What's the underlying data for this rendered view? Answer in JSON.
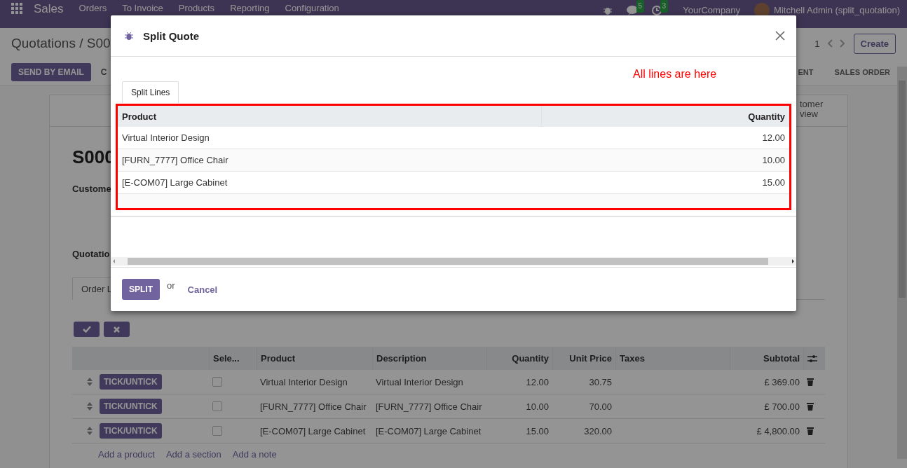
{
  "navbar": {
    "app": "Sales",
    "menu": [
      "Orders",
      "To Invoice",
      "Products",
      "Reporting",
      "Configuration"
    ],
    "chat_count": "5",
    "activity_count": "3",
    "company": "YourCompany",
    "user": "Mitchell Admin (split_quotation)"
  },
  "control_panel": {
    "breadcrumb": "Quotations / S00",
    "pager": "1",
    "create": "Create",
    "actions": [
      "SEND BY EMAIL",
      "C"
    ],
    "stages": [
      "ENT",
      "SALES ORDER"
    ]
  },
  "form": {
    "smart_button": "tomer view",
    "title": "S000",
    "fields": [
      "Custome",
      "Quotatio"
    ],
    "tab": "Order L",
    "table": {
      "columns": [
        "Sele...",
        "Product",
        "Description",
        "Quantity",
        "Unit Price",
        "Taxes",
        "Subtotal"
      ],
      "rows": [
        {
          "button": "TICK/UNTICK",
          "checked": false,
          "product": "Virtual Interior Design",
          "description": "Virtual Interior Design",
          "quantity": "12.00",
          "unit_price": "30.75",
          "subtotal": "£ 369.00"
        },
        {
          "button": "TICK/UNTICK",
          "checked": false,
          "product": "[FURN_7777] Office Chair",
          "description": "[FURN_7777] Office Chair",
          "quantity": "10.00",
          "unit_price": "70.00",
          "subtotal": "£ 700.00"
        },
        {
          "button": "TICK/UNTICK",
          "checked": false,
          "product": "[E-COM07] Large Cabinet",
          "description": "[E-COM07] Large Cabinet",
          "quantity": "15.00",
          "unit_price": "320.00",
          "subtotal": "£ 4,800.00"
        }
      ]
    },
    "add_links": [
      "Add a product",
      "Add a section",
      "Add a note"
    ]
  },
  "dialog": {
    "title": "Split Quote",
    "note": "All lines are here",
    "tab": {
      "label": "Split Lines",
      "selected": true
    },
    "table": {
      "columns": [
        "Product",
        "Quantity"
      ],
      "rows": [
        {
          "product": "Virtual Interior Design",
          "quantity": "12.00"
        },
        {
          "product": "[FURN_7777] Office Chair",
          "quantity": "10.00"
        },
        {
          "product": "[E-COM07] Large Cabinet",
          "quantity": "15.00"
        }
      ]
    },
    "primary": "SPLIT",
    "separator": "or",
    "cancel": "Cancel"
  }
}
